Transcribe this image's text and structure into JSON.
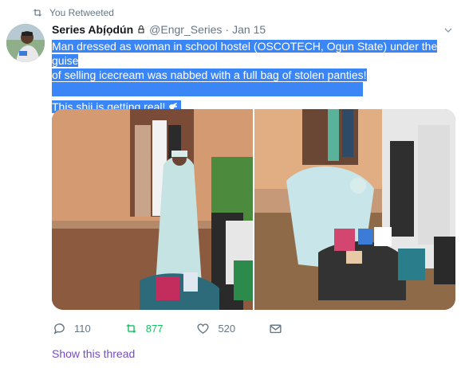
{
  "retweet": {
    "label": "You Retweeted",
    "icon": "retweet-icon"
  },
  "author": {
    "name": "Series Abí̗ọdún",
    "handle": "@Engr_Series",
    "separator": "·",
    "date": "Jan 15",
    "badge_icon": "lock-icon"
  },
  "tweet": {
    "line1": "Man dressed as woman in school hostel (OSCOTECH, Ogun State) under the guise",
    "line2": "of selling icecream was nabbed with a full bag of stolen panties!",
    "line3": "This shii is getting real!",
    "emoji_icon": "hand-icon"
  },
  "media": {
    "photos": [
      "photo-1",
      "photo-2"
    ]
  },
  "actions": {
    "reply_count": "110",
    "retweet_count": "877",
    "like_count": "520"
  },
  "thread_link": "Show this thread",
  "colors": {
    "highlight": "#3b86f7",
    "retweet_green": "#17bf63",
    "muted": "#657786",
    "link_purple": "#794bc4"
  }
}
